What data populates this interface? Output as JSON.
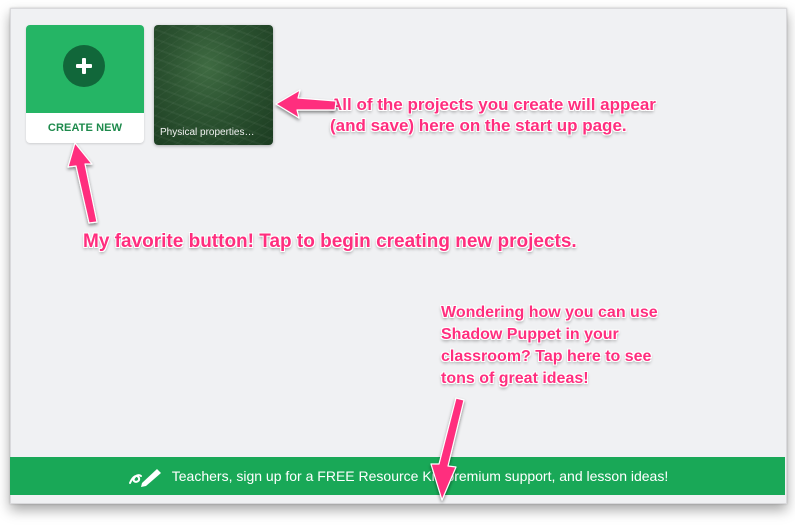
{
  "start_page": {
    "create_new": {
      "label": "CREATE NEW",
      "icon": "plus-icon"
    },
    "projects": [
      {
        "title": "Physical properties…"
      }
    ]
  },
  "annotations": {
    "projects_note": [
      "All of the projects you create will appear",
      "(and save) here on the start up page."
    ],
    "create_note": "My favorite button!  Tap to begin creating new projects.",
    "ideas_note": [
      "Wondering how you can use",
      "Shadow Puppet in your",
      "classroom?  Tap here to see",
      "tons of great ideas!"
    ]
  },
  "footer": {
    "icon": "teacher-pencil-icon",
    "text": "Teachers, sign up for a FREE Resource Kit, premium support, and lesson ideas!"
  },
  "colors": {
    "accent_green": "#25b565",
    "annotation_pink": "#ff2e7e",
    "footer_green": "#19a857"
  }
}
